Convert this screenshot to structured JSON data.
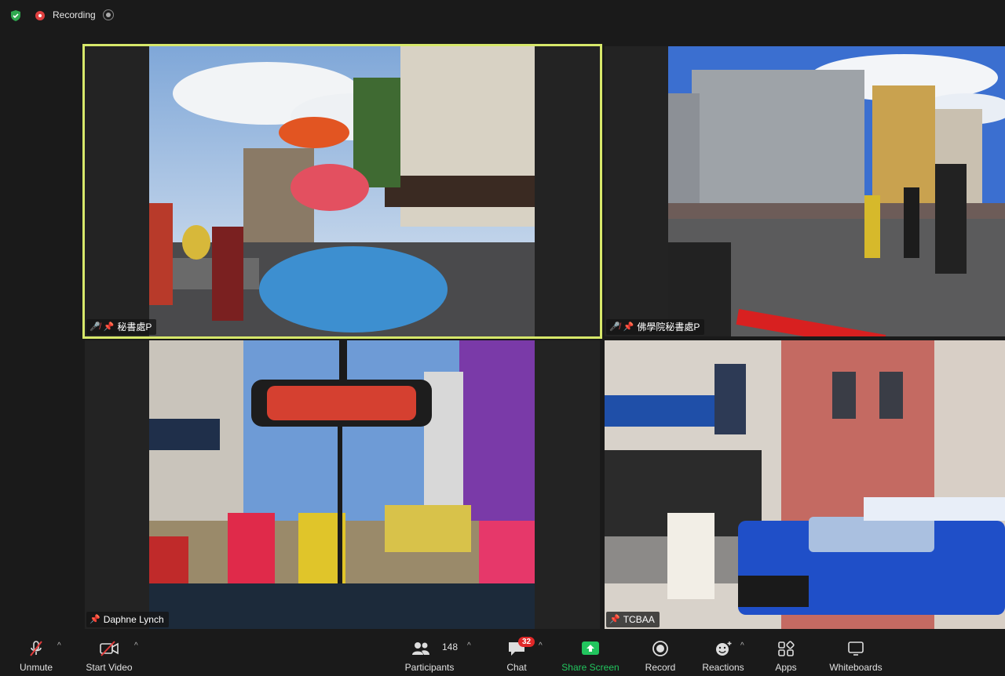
{
  "topbar": {
    "recording_label": "Recording",
    "shield_color": "#2fa84f",
    "recording_color": "#e04040"
  },
  "tiles": [
    {
      "name": "秘書處P",
      "muted": true,
      "pinned": true,
      "active_speaker": true
    },
    {
      "name": "佛學院秘書處P",
      "muted": true,
      "pinned": true,
      "active_speaker": false
    },
    {
      "name": "Daphne Lynch",
      "muted": false,
      "pinned": true,
      "active_speaker": false
    },
    {
      "name": "TCBAA",
      "muted": false,
      "pinned": true,
      "active_speaker": false
    }
  ],
  "active_speaker_color": "#d7e86a",
  "toolbar": {
    "unmute_label": "Unmute",
    "start_video_label": "Start Video",
    "participants_label": "Participants",
    "participants_count": "148",
    "chat_label": "Chat",
    "chat_badge": "32",
    "share_label": "Share Screen",
    "share_color": "#22c55e",
    "record_label": "Record",
    "reactions_label": "Reactions",
    "apps_label": "Apps",
    "whiteboards_label": "Whiteboards"
  }
}
